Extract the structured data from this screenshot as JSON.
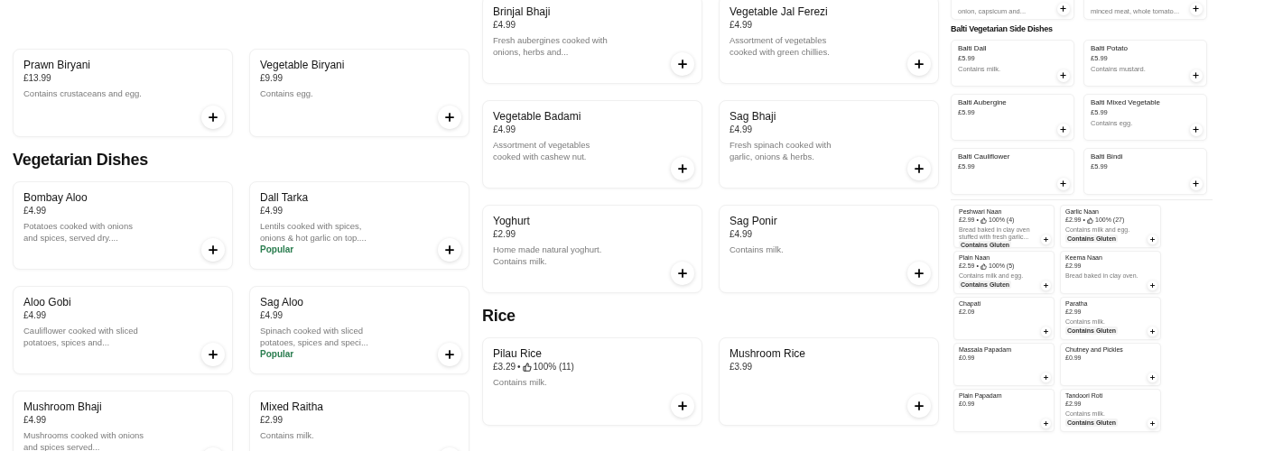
{
  "columns": [
    {
      "blocks": [
        {
          "kind": "grid",
          "items": [
            {
              "name": "Prawn Biryani",
              "price": "£13.99",
              "description": "Contains crustaceans and egg."
            },
            {
              "name": "Vegetable Biryani",
              "price": "£9.99",
              "description": "Contains egg."
            }
          ]
        },
        {
          "kind": "heading",
          "text": "Vegetarian Dishes"
        },
        {
          "kind": "grid",
          "items": [
            {
              "name": "Bombay Aloo",
              "price": "£4.99",
              "description": "Potatoes cooked with onions and spices, served dry...."
            },
            {
              "name": "Dall Tarka",
              "price": "£4.99",
              "description": "Lentils cooked with spices, onions & hot garlic on top....",
              "badge": {
                "kind": "popular",
                "text": "Popular"
              }
            },
            {
              "name": "Aloo Gobi",
              "price": "£4.99",
              "description": "Cauliflower cooked with sliced potatoes, spices and..."
            },
            {
              "name": "Sag Aloo",
              "price": "£4.99",
              "description": "Spinach cooked with sliced potatoes, spices and speci...",
              "badge": {
                "kind": "popular",
                "text": "Popular"
              }
            },
            {
              "name": "Mushroom Bhaji",
              "price": "£4.99",
              "description": "Mushrooms cooked with onions and spices served..."
            },
            {
              "name": "Mixed Raitha",
              "price": "£2.99",
              "description": "Contains milk."
            }
          ]
        }
      ]
    },
    {
      "blocks": [
        {
          "kind": "grid",
          "items": [
            {
              "name": "Brinjal Bhaji",
              "price": "£4.99",
              "description": "Fresh aubergines cooked with onions, herbs and..."
            },
            {
              "name": "Vegetable Jal Ferezi",
              "price": "£4.99",
              "description": "Assortment of vegetables cooked with green chillies."
            },
            {
              "name": "Vegetable Badami",
              "price": "£4.99",
              "description": "Assortment of vegetables cooked with cashew nut."
            },
            {
              "name": "Sag Bhaji",
              "price": "£4.99",
              "description": "Fresh spinach cooked with garlic, onions & herbs."
            },
            {
              "name": "Yoghurt",
              "price": "£2.99",
              "description": "Home made natural yoghurt. Contains milk."
            },
            {
              "name": "Sag Ponir",
              "price": "£4.99",
              "description": "Contains milk."
            }
          ]
        },
        {
          "kind": "heading",
          "text": "Rice"
        },
        {
          "kind": "grid",
          "items": [
            {
              "name": "Pilau Rice",
              "price": "£3.29",
              "separator": "•",
              "rating": "100% (11)",
              "description": "Contains milk."
            },
            {
              "name": "Mushroom Rice",
              "price": "£3.99"
            }
          ]
        }
      ]
    },
    {
      "blocks": [
        {
          "kind": "grid",
          "items": [
            {
              "description": "onion, capsicum and..."
            },
            {
              "description": "minced meat, whole tomato..."
            }
          ]
        },
        {
          "kind": "heading",
          "text": "Balti Vegetarian Side Dishes"
        },
        {
          "kind": "grid",
          "items": [
            {
              "name": "Balti Dall",
              "price": "£5.99",
              "description": "Contains milk."
            },
            {
              "name": "Balti Potato",
              "price": "£5.99",
              "description": "Contains mustard."
            },
            {
              "name": "Balti Aubergine",
              "price": "£5.99"
            },
            {
              "name": "Balti Mixed Vegetable",
              "price": "£5.99",
              "description": "Contains egg."
            },
            {
              "name": "Balti Cauliflower",
              "price": "£5.99"
            },
            {
              "name": "Balti Bindi",
              "price": "£5.99"
            }
          ]
        },
        {
          "kind": "grid",
          "items": [
            {
              "name": "Peshwari Naan",
              "price": "£2.99",
              "separator": "•",
              "rating": "100% (4)",
              "description": "Bread baked in clay oven stuffed with fresh garlic...",
              "badge": {
                "kind": "allergen",
                "text": "Contains Gluten"
              }
            },
            {
              "name": "Garlic Naan",
              "price": "£2.99",
              "separator": "•",
              "rating": "100% (27)",
              "description": "Contains milk and egg.",
              "badge": {
                "kind": "allergen",
                "text": "Contains Gluten"
              }
            },
            {
              "name": "Plain Naan",
              "price": "£2.59",
              "separator": "•",
              "rating": "100% (5)",
              "description": "Contains milk and egg.",
              "badge": {
                "kind": "allergen",
                "text": "Contains Gluten"
              }
            },
            {
              "name": "Keema Naan",
              "price": "£2.99",
              "description": "Bread baked in clay oven."
            },
            {
              "name": "Chapati",
              "price": "£2.09"
            },
            {
              "name": "Paratha",
              "price": "£2.99",
              "description": "Contains milk.",
              "badge": {
                "kind": "allergen",
                "text": "Contains Gluten"
              }
            },
            {
              "name": "Massala Papadam",
              "price": "£0.99"
            },
            {
              "name": "Chutney and Pickles",
              "price": "£0.99"
            },
            {
              "name": "Plain Papadam",
              "price": "£0.99"
            },
            {
              "name": "Tandoori Roti",
              "price": "£2.99",
              "description": "Contains milk.",
              "badge": {
                "kind": "allergen",
                "text": "Contains Gluten"
              }
            }
          ]
        }
      ]
    }
  ]
}
